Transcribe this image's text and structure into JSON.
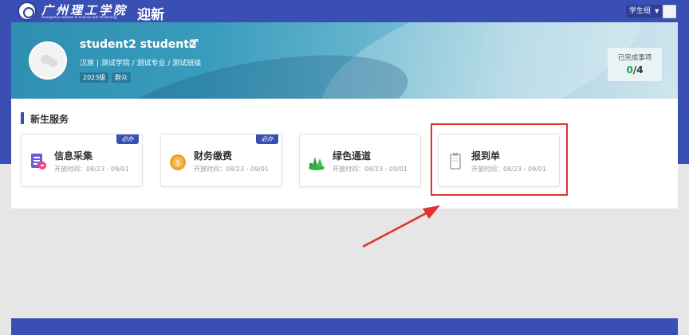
{
  "header": {
    "logo_cn": "广州理工学院",
    "logo_en": "Guangzhou Institute of Science and Technology",
    "title": "迎新",
    "role_label": "学生组"
  },
  "profile": {
    "name": "student2  student2",
    "gender_symbol": "♂",
    "info": "汉族 | 测试学院 / 测试专业 / 测试班级",
    "tags": [
      "2023级",
      "群众"
    ],
    "progress_label": "已完成事项",
    "progress_done": "0",
    "progress_total": "/4"
  },
  "services": {
    "section_title": "新生服务",
    "cards": [
      {
        "title": "信息采集",
        "time": "开放时间：08/23 - 09/01",
        "badge": "必办",
        "icon": "form-icon"
      },
      {
        "title": "财务缴费",
        "time": "开放时间：08/23 - 09/01",
        "badge": "必办",
        "icon": "coin-icon"
      },
      {
        "title": "绿色通道",
        "time": "开放时间：08/23 - 09/01",
        "badge": "",
        "icon": "green-channel-icon"
      },
      {
        "title": "报到单",
        "time": "开放时间：08/23 - 09/01",
        "badge": "",
        "icon": "clipboard-icon"
      }
    ]
  },
  "colors": {
    "primary": "#3a4fb3",
    "highlight": "#e0322c",
    "done": "#1aa34a"
  }
}
